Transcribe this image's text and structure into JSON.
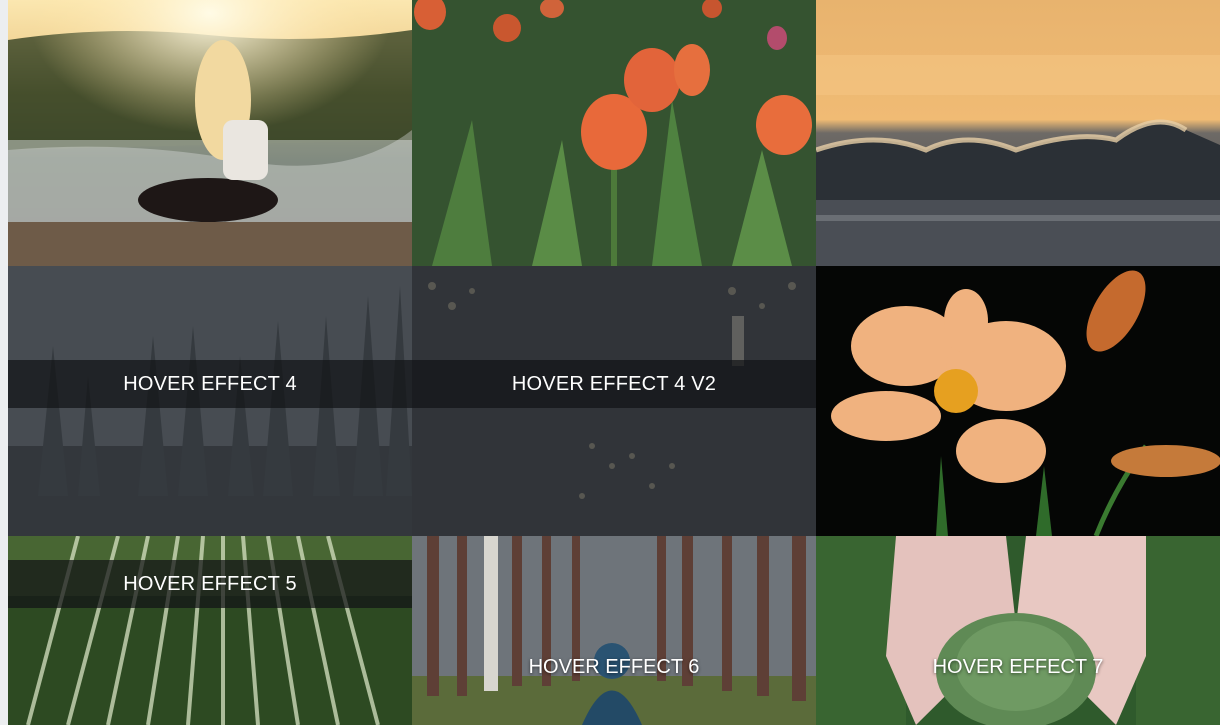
{
  "gallery": {
    "tiles": [
      {
        "caption": ""
      },
      {
        "caption": ""
      },
      {
        "caption": ""
      },
      {
        "caption": "HOVER EFFECT 4"
      },
      {
        "caption": "HOVER EFFECT 4 V2"
      },
      {
        "caption": ""
      },
      {
        "caption": "HOVER EFFECT 5"
      },
      {
        "caption": "HOVER EFFECT 6"
      },
      {
        "caption": "HOVER EFFECT 7"
      }
    ]
  }
}
